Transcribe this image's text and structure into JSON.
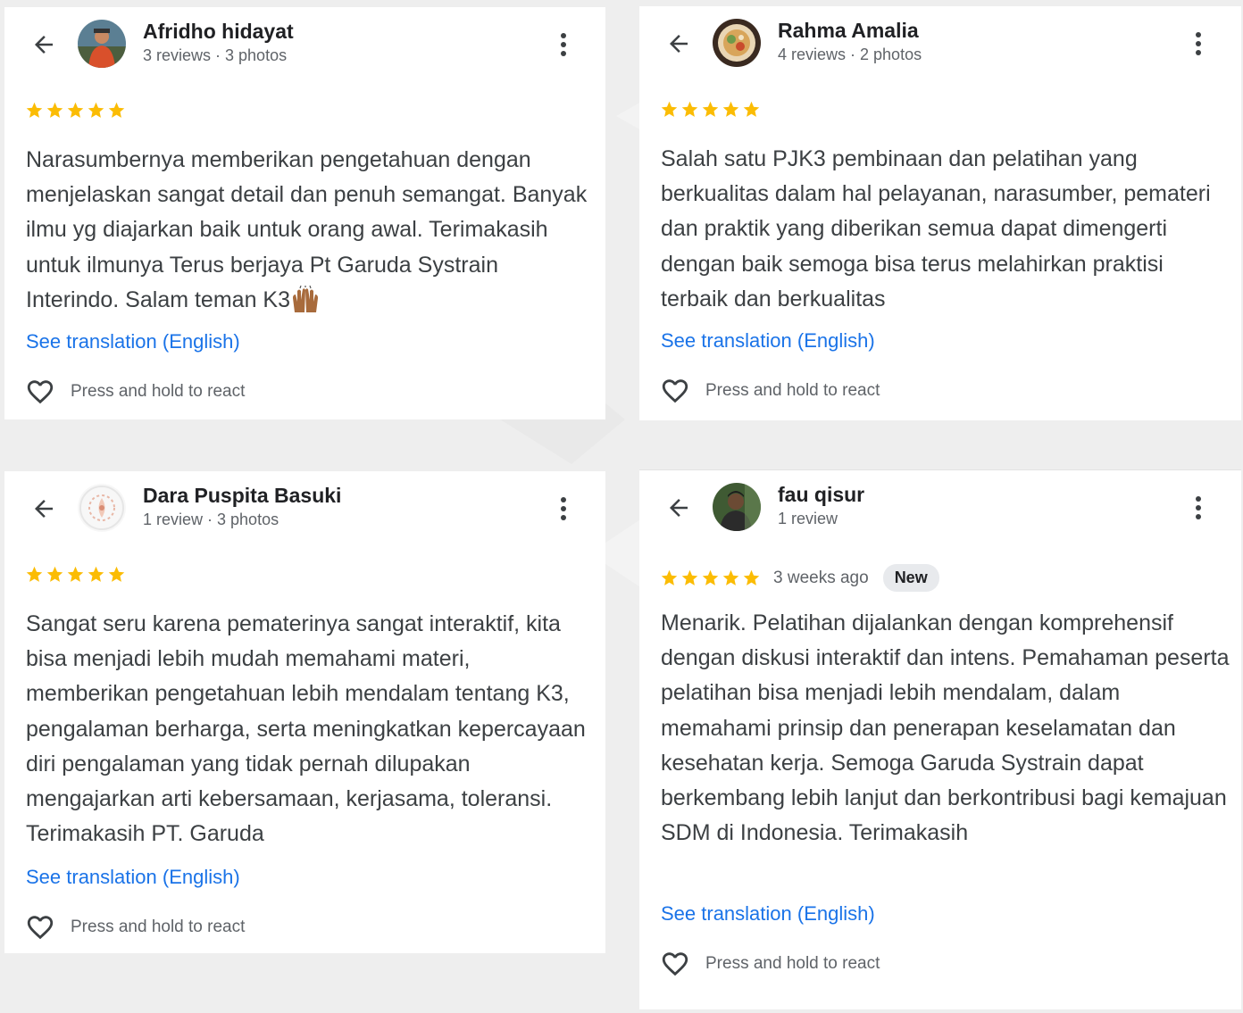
{
  "colors": {
    "star": "#fbbc04",
    "link": "#1a73e8",
    "text": "#3c4043",
    "secondary": "#5f6368"
  },
  "reviews": [
    {
      "name": "Afridho hidayat",
      "meta": "3 reviews · 3 photos",
      "rating": 5,
      "text": "Narasumbernya memberikan pengetahuan dengan menjelaskan sangat detail dan penuh semangat. Banyak ilmu yg diajarkan baik untuk orang awal. Terimakasih untuk ilmunya Terus berjaya Pt Garuda Systrain Interindo. Salam teman K3",
      "emoji": "raising-hands-emoji",
      "translation_link": "See translation (English)",
      "react_label": "Press and hold to react"
    },
    {
      "name": "Rahma Amalia",
      "meta": "4 reviews · 2 photos",
      "rating": 5,
      "text": "Salah satu PJK3 pembinaan dan pelatihan yang berkualitas dalam hal pelayanan, narasumber, pemateri dan praktik yang diberikan semua dapat dimengerti dengan baik semoga bisa terus melahirkan praktisi terbaik dan berkualitas",
      "translation_link": "See translation (English)",
      "react_label": "Press and hold to react"
    },
    {
      "name": "Dara Puspita Basuki",
      "meta": "1 review · 3 photos",
      "rating": 5,
      "text": "Sangat seru karena pematerinya sangat interaktif, kita bisa menjadi lebih mudah memahami materi, memberikan pengetahuan lebih mendalam tentang K3, pengalaman berharga, serta meningkatkan kepercayaan diri pengalaman yang tidak pernah dilupakan mengajarkan arti kebersamaan, kerjasama, toleransi. Terimakasih PT. Garuda",
      "translation_link": "See translation (English)",
      "react_label": "Press and hold to react"
    },
    {
      "name": "fau qisur",
      "meta": "1 review",
      "rating": 5,
      "date": "3 weeks ago",
      "badge": "New",
      "text": "Menarik. Pelatihan dijalankan dengan komprehensif dengan diskusi interaktif dan intens. Pemahaman peserta pelatihan bisa menjadi lebih mendalam, dalam memahami prinsip dan penerapan keselamatan dan kesehatan kerja. Semoga Garuda Systrain dapat berkembang lebih lanjut dan berkontribusi bagi kemajuan SDM di Indonesia. Terimakasih",
      "translation_link": "See translation (English)",
      "react_label": "Press and hold to react"
    }
  ],
  "icons": {
    "back": "arrow-back-icon",
    "more": "more-vert-icon",
    "star": "star-icon",
    "react": "heart-outline-icon"
  }
}
